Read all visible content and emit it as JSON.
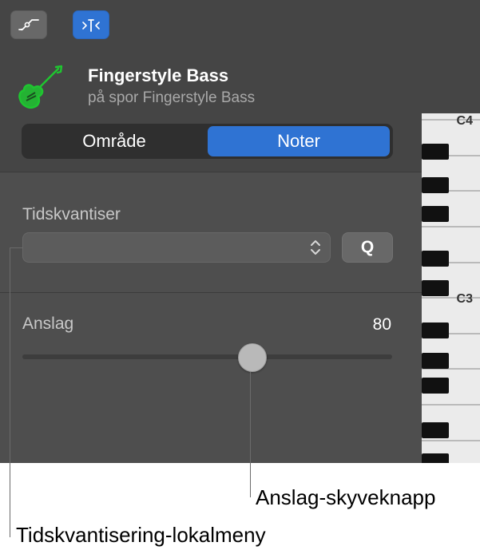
{
  "toolbar": {
    "automation_button_icon": "automation-curve-icon",
    "editor_button_icon": "piano-roll-editor-icon",
    "accent": "#2f73d3"
  },
  "track": {
    "icon": "bass-guitar-icon",
    "icon_color": "#1fc630",
    "name": "Fingerstyle Bass",
    "subtitle": "på spor Fingerstyle Bass"
  },
  "mode_tabs": {
    "region_label": "Område",
    "notes_label": "Noter",
    "selected": "Noter"
  },
  "quantize": {
    "label": "Tidskvantiser",
    "selected_value": "",
    "q_button_label": "Q"
  },
  "velocity": {
    "label": "Anslag",
    "value": "80",
    "slider_fraction": 0.622
  },
  "piano": {
    "c4_label": "C4",
    "c3_label": "C3"
  },
  "callouts": {
    "velocity_slider": "Anslag-skyveknapp",
    "quantize_menu": "Tidskvantisering-lokalmeny"
  }
}
